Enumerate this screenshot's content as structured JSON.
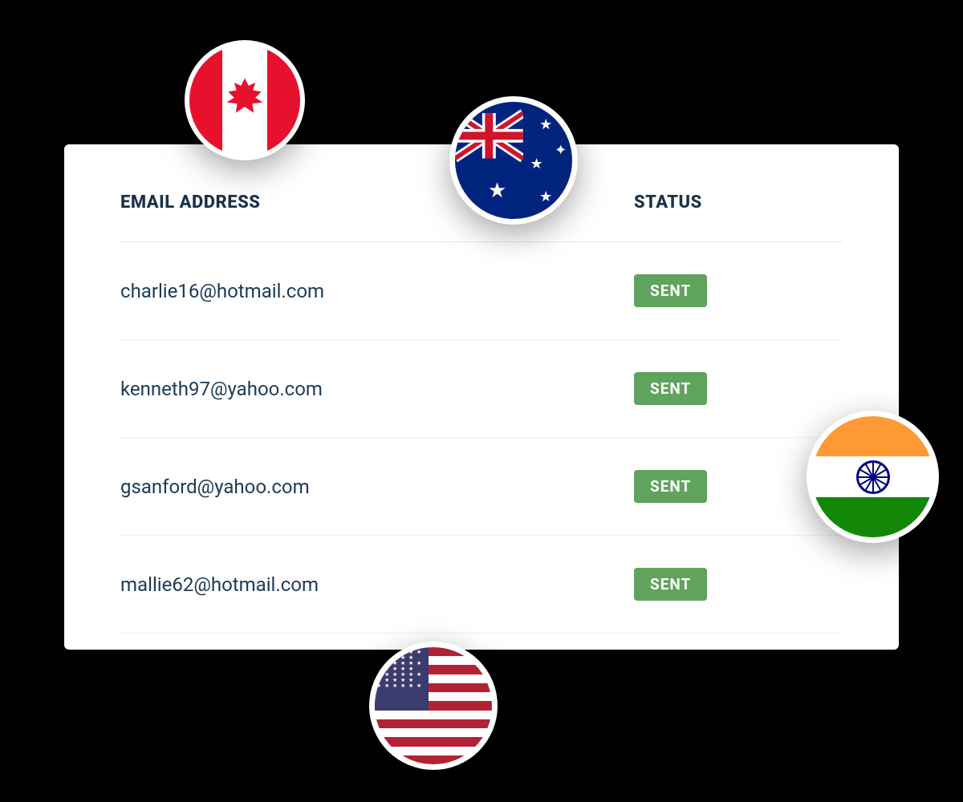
{
  "table": {
    "headers": {
      "email": "EMAIL ADDRESS",
      "status": "STATUS"
    },
    "rows": [
      {
        "email": "charlie16@hotmail.com",
        "status": "SENT"
      },
      {
        "email": "kenneth97@yahoo.com",
        "status": "SENT"
      },
      {
        "email": "gsanford@yahoo.com",
        "status": "SENT"
      },
      {
        "email": "mallie62@hotmail.com",
        "status": "SENT"
      }
    ]
  },
  "flags": {
    "canada": "flag-canada",
    "australia": "flag-australia",
    "india": "flag-india",
    "usa": "flag-usa"
  }
}
